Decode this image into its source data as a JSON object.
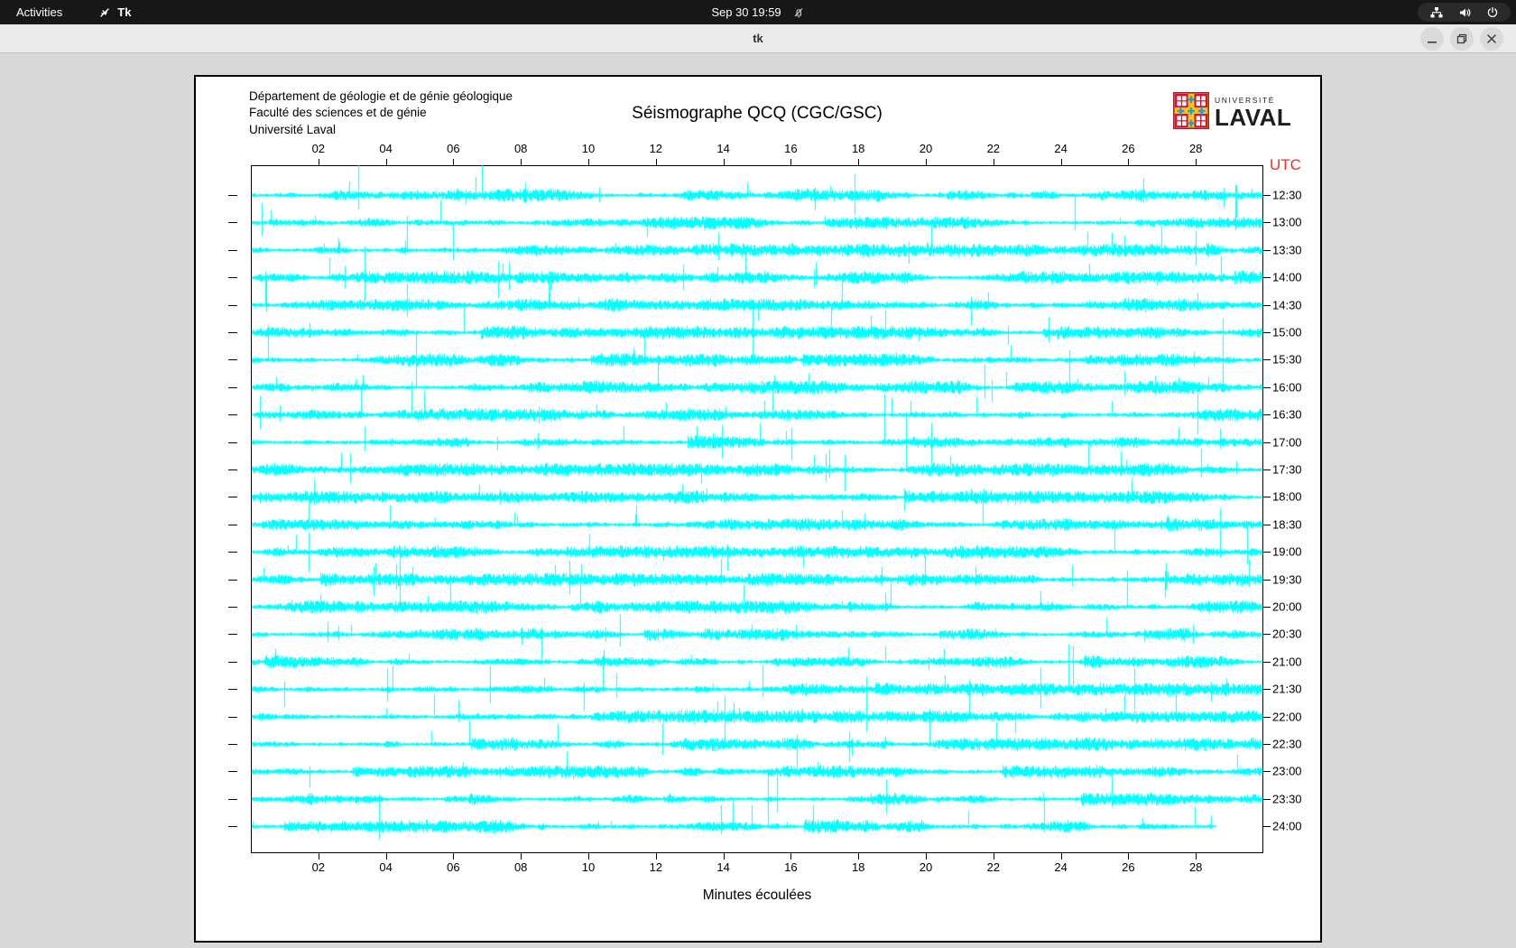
{
  "system_bar": {
    "activities_label": "Activities",
    "app_name": "Tk",
    "clock": "Sep 30 19:59",
    "icons": [
      "tk-feather-icon",
      "notifications-muted-bell-icon",
      "network-wired-icon",
      "volume-icon",
      "power-icon"
    ]
  },
  "window": {
    "title": "tk",
    "controls": [
      "minimize",
      "maximize",
      "close"
    ]
  },
  "seismograph": {
    "institution_lines": [
      "Département de géologie et de génie géologique",
      "Faculté des sciences et de génie",
      "Université Laval"
    ],
    "title": "Séismographe QCQ (CGC/GSC)",
    "logo": {
      "top_text": "UNIVERSITÉ",
      "bottom_text": "LAVAL"
    },
    "utc_label": "UTC",
    "x_axis_label": "Minutes écoulées",
    "x_ticks": [
      "02",
      "04",
      "06",
      "08",
      "10",
      "12",
      "14",
      "16",
      "18",
      "20",
      "22",
      "24",
      "26",
      "28"
    ],
    "axis": {
      "minutes_min": 0,
      "minutes_max": 30
    },
    "row_times": [
      "12:30",
      "13:00",
      "13:30",
      "14:00",
      "14:30",
      "15:00",
      "15:30",
      "16:00",
      "16:30",
      "17:00",
      "17:30",
      "18:00",
      "18:30",
      "19:00",
      "19:30",
      "20:00",
      "20:30",
      "21:00",
      "21:30",
      "22:00",
      "22:30",
      "23:00",
      "23:30",
      "24:00"
    ],
    "last_row_end_minute": 28.6,
    "trace_color": "#00ffff",
    "utc_color": "#fb2a1e"
  }
}
